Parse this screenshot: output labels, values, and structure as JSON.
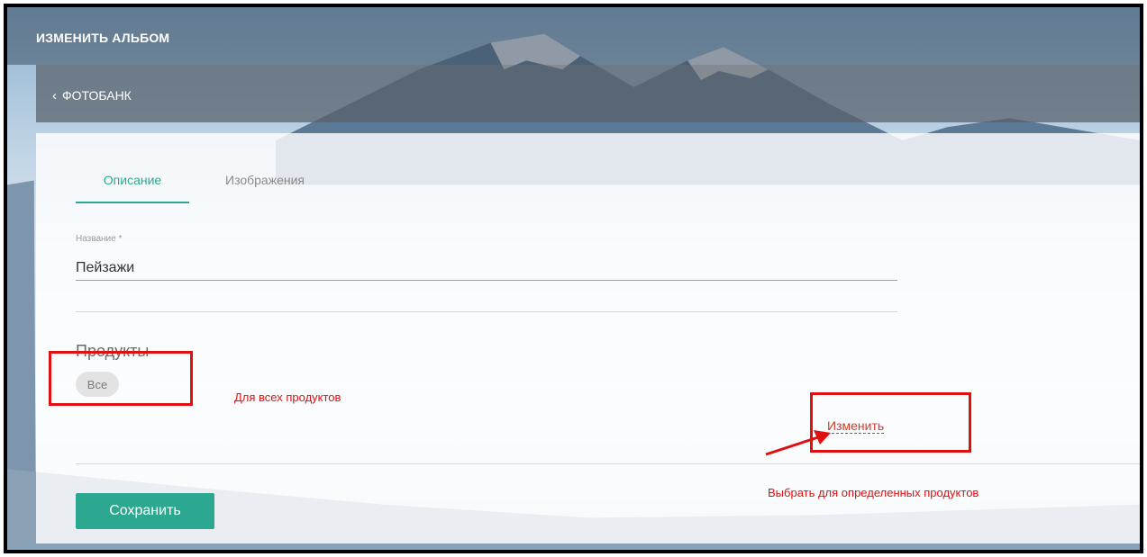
{
  "header": {
    "title": "ИЗМЕНИТЬ АЛЬБОМ"
  },
  "nav": {
    "back_label": "ФОТОБАНК"
  },
  "tabs": [
    {
      "label": "Описание",
      "active": true
    },
    {
      "label": "Изображения",
      "active": false
    }
  ],
  "form": {
    "name_label": "Название *",
    "name_value": "Пейзажи",
    "products_heading": "Продукты",
    "products_chip": "Все",
    "change_link": "Изменить",
    "save_button": "Сохранить"
  },
  "annotations": {
    "all_products": "Для всех продуктов",
    "choose_specific": "Выбрать для определенных продуктов"
  },
  "colors": {
    "accent": "#2ba88f",
    "annotation_red": "#e01010",
    "link_red": "#d23a2a"
  },
  "icons": {
    "back": "chevron-left-icon"
  }
}
